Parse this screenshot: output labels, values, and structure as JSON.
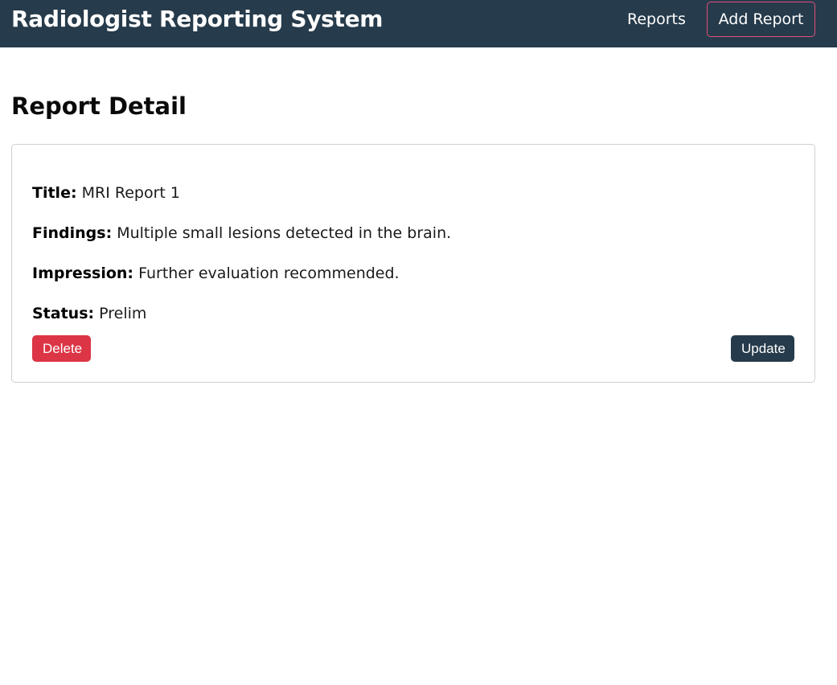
{
  "header": {
    "brand": "Radiologist Reporting System",
    "nav_reports": "Reports",
    "nav_add_report": "Add Report"
  },
  "page": {
    "title": "Report Detail"
  },
  "report": {
    "title_label": "Title:",
    "title_value": "MRI Report 1",
    "findings_label": "Findings:",
    "findings_value": "Multiple small lesions detected in the brain.",
    "impression_label": "Impression:",
    "impression_value": "Further evaluation recommended.",
    "status_label": "Status:",
    "status_value": "Prelim"
  },
  "actions": {
    "delete_label": "Delete",
    "update_label": "Update"
  },
  "colors": {
    "navbar_bg": "#263b4b",
    "add_report_border": "#e34f7e",
    "delete_bg": "#dc3545",
    "update_bg": "#263b4b"
  }
}
